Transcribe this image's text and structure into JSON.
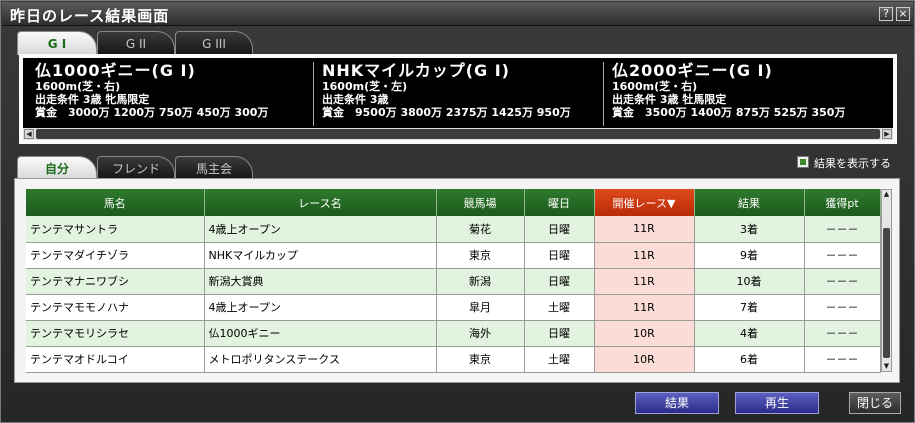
{
  "window": {
    "title": "昨日のレース結果画面",
    "help_label": "?",
    "close_label": "×"
  },
  "grade_tabs": [
    {
      "label": "G I",
      "active": true
    },
    {
      "label": "G II",
      "active": false
    },
    {
      "label": "G III",
      "active": false
    }
  ],
  "races": [
    {
      "name": "仏1000ギニー(G I)",
      "distance": "1600m(芝・右)",
      "condition": "出走条件 3歳 牝馬限定",
      "prize": "賞金　3000万 1200万 750万 450万 300万"
    },
    {
      "name": "NHKマイルカップ(G I)",
      "distance": "1600m(芝・左)",
      "condition": "出走条件 3歳",
      "prize": "賞金　9500万 3800万 2375万 1425万 950万"
    },
    {
      "name": "仏2000ギニー(G I)",
      "distance": "1600m(芝・右)",
      "condition": "出走条件 3歳 牡馬限定",
      "prize": "賞金　3500万 1400万 875万 525万 350万"
    }
  ],
  "owner_tabs": [
    {
      "label": "自分",
      "active": true
    },
    {
      "label": "フレンド",
      "active": false
    },
    {
      "label": "馬主会",
      "active": false
    }
  ],
  "show_results": {
    "label": "結果を表示する",
    "checked": true
  },
  "table": {
    "headers": [
      "馬名",
      "レース名",
      "競馬場",
      "曜日",
      "開催レース▼",
      "結果",
      "獲得pt"
    ],
    "rows": [
      [
        "テンテマサントラ",
        "4歳上オープン",
        "菊花",
        "日曜",
        "11R",
        "3着",
        "－－－"
      ],
      [
        "テンテマダイチゾラ",
        "NHKマイルカップ",
        "東京",
        "日曜",
        "11R",
        "9着",
        "－－－"
      ],
      [
        "テンテマナニワブシ",
        "新潟大賞典",
        "新潟",
        "日曜",
        "11R",
        "10着",
        "－－－"
      ],
      [
        "テンテマモモノハナ",
        "4歳上オープン",
        "皐月",
        "土曜",
        "11R",
        "7着",
        "－－－"
      ],
      [
        "テンテマモリシラセ",
        "仏1000ギニー",
        "海外",
        "日曜",
        "10R",
        "4着",
        "－－－"
      ],
      [
        "テンテマオドルコイ",
        "メトロポリタンステークス",
        "東京",
        "土曜",
        "10R",
        "6着",
        "－－－"
      ]
    ]
  },
  "buttons": {
    "result": "結果",
    "replay": "再生",
    "close": "閉じる"
  },
  "colors": {
    "header_green": "#1b5a1b",
    "sorted_header": "#c8380e",
    "row_green": "#e2f3df",
    "button_blue": "#3a3ca0"
  }
}
